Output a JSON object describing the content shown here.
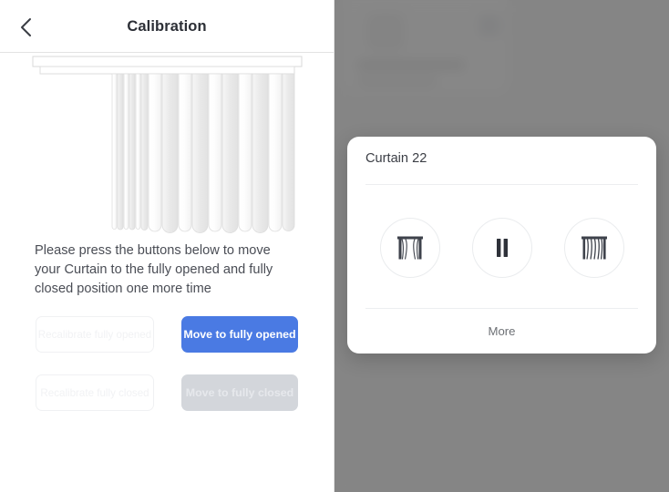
{
  "left": {
    "nav": {
      "back_icon": "chevron-left-icon",
      "title": "Calibration"
    },
    "illustration": {
      "name": "curtain-illustration",
      "description": "Curtain rail with vertically pleated curtain partially closed"
    },
    "instruction": "Please press the buttons below to move your Curtain to the fully opened and fully closed position one more time",
    "buttons": {
      "recalibrate_opened": "Recalibrate fully opened",
      "move_opened": "Move to fully opened",
      "recalibrate_closed": "Recalibrate fully closed",
      "move_closed": "Move to fully closed"
    }
  },
  "right": {
    "modal": {
      "title": "Curtain 22",
      "controls": [
        {
          "name": "open-curtain-button",
          "icon": "curtain-open-icon"
        },
        {
          "name": "pause-curtain-button",
          "icon": "pause-icon"
        },
        {
          "name": "close-curtain-button",
          "icon": "curtain-closed-icon"
        }
      ],
      "more_label": "More"
    }
  },
  "colors": {
    "accent_blue": "#4a7ae3",
    "disabled_gray": "#d3d6db",
    "scrim": "#6a6a6a",
    "text_primary": "#2c2f36",
    "text_secondary": "#4a4d55"
  }
}
